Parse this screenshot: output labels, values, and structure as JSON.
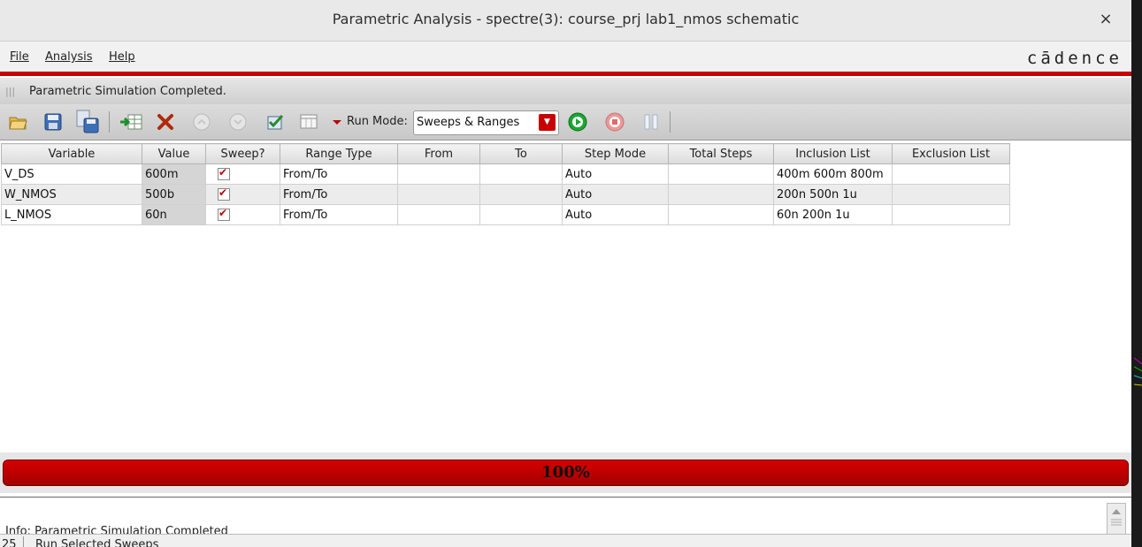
{
  "window": {
    "title": "Parametric Analysis - spectre(3): course_prj lab1_nmos schematic",
    "close_glyph": "×"
  },
  "menu": {
    "items": [
      "File",
      "Analysis",
      "Help"
    ],
    "brand": "cādence"
  },
  "status": {
    "message": "Parametric Simulation Completed."
  },
  "toolbar": {
    "run_mode_label": "Run Mode:",
    "run_mode_value": "Sweeps & Ranges",
    "icons": [
      "open-folder-icon",
      "save-icon",
      "save-as-icon",
      "add-variable-icon",
      "delete-icon",
      "move-up-icon",
      "move-down-icon",
      "check-icon",
      "table-view-icon",
      "run-icon",
      "stop-icon",
      "pause-icon"
    ]
  },
  "table": {
    "columns": [
      "Variable",
      "Value",
      "Sweep?",
      "Range Type",
      "From",
      "To",
      "Step Mode",
      "Total Steps",
      "Inclusion List",
      "Exclusion List"
    ],
    "rows": [
      {
        "variable": "V_DS",
        "value": "600m",
        "sweep": true,
        "range_type": "From/To",
        "from": "",
        "to": "",
        "step_mode": "Auto",
        "total_steps": "",
        "inclusion": "400m 600m 800m",
        "exclusion": ""
      },
      {
        "variable": "W_NMOS",
        "value": "500b",
        "sweep": true,
        "range_type": "From/To",
        "from": "",
        "to": "",
        "step_mode": "Auto",
        "total_steps": "",
        "inclusion": "200n 500n 1u",
        "exclusion": ""
      },
      {
        "variable": "L_NMOS",
        "value": "60n",
        "sweep": true,
        "range_type": "From/To",
        "from": "",
        "to": "",
        "step_mode": "Auto",
        "total_steps": "",
        "inclusion": "60n 200n 1u",
        "exclusion": ""
      }
    ]
  },
  "progress": {
    "percent": 100,
    "label": "100%"
  },
  "log": {
    "text": "Info: Parametric Simulation Completed"
  },
  "bottom": {
    "line_number": "25",
    "command": "Run Selected Sweeps"
  },
  "colors": {
    "accent_red": "#c90000",
    "run_green": "#1aa832",
    "stop_red": "#e06a6a"
  }
}
